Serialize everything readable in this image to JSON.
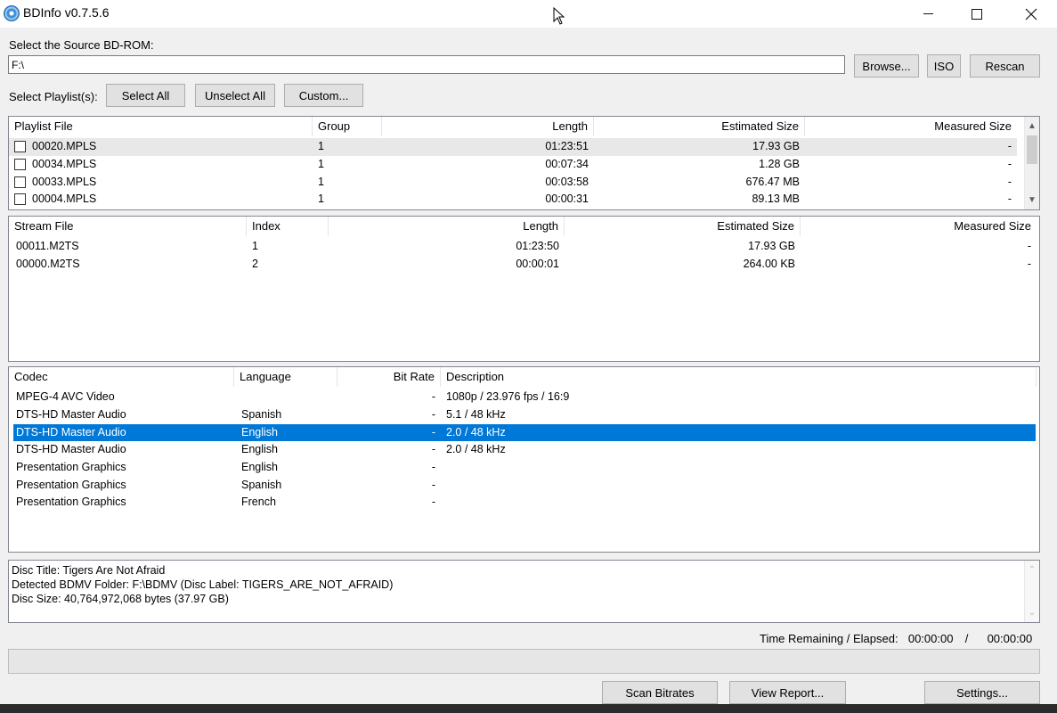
{
  "window": {
    "title": "BDInfo v0.7.5.6"
  },
  "source": {
    "label": "Select the Source BD-ROM:",
    "path": "F:\\",
    "browse": "Browse...",
    "iso": "ISO",
    "rescan": "Rescan"
  },
  "playlist_select": {
    "label": "Select Playlist(s):",
    "select_all": "Select All",
    "unselect_all": "Unselect All",
    "custom": "Custom..."
  },
  "playlists": {
    "columns": [
      "Playlist File",
      "Group",
      "Length",
      "Estimated Size",
      "Measured Size"
    ],
    "rows": [
      {
        "file": "00020.MPLS",
        "group": "1",
        "length": "01:23:51",
        "est": "17.93 GB",
        "meas": "-"
      },
      {
        "file": "00034.MPLS",
        "group": "1",
        "length": "00:07:34",
        "est": "1.28 GB",
        "meas": "-"
      },
      {
        "file": "00033.MPLS",
        "group": "1",
        "length": "00:03:58",
        "est": "676.47 MB",
        "meas": "-"
      },
      {
        "file": "00004.MPLS",
        "group": "1",
        "length": "00:00:31",
        "est": "89.13 MB",
        "meas": "-"
      }
    ]
  },
  "streams": {
    "columns": [
      "Stream File",
      "Index",
      "Length",
      "Estimated Size",
      "Measured Size"
    ],
    "rows": [
      {
        "file": "00011.M2TS",
        "index": "1",
        "length": "01:23:50",
        "est": "17.93 GB",
        "meas": "-"
      },
      {
        "file": "00000.M2TS",
        "index": "2",
        "length": "00:00:01",
        "est": "264.00 KB",
        "meas": "-"
      }
    ]
  },
  "codecs": {
    "columns": [
      "Codec",
      "Language",
      "Bit Rate",
      "Description"
    ],
    "rows": [
      {
        "codec": "MPEG-4 AVC Video",
        "lang": "",
        "bitrate": "-",
        "desc": "1080p / 23.976 fps / 16:9"
      },
      {
        "codec": "DTS-HD Master Audio",
        "lang": "Spanish",
        "bitrate": "-",
        "desc": "5.1 / 48 kHz"
      },
      {
        "codec": "DTS-HD Master Audio",
        "lang": "English",
        "bitrate": "-",
        "desc": "2.0 / 48 kHz"
      },
      {
        "codec": "DTS-HD Master Audio",
        "lang": "English",
        "bitrate": "-",
        "desc": "2.0 / 48 kHz"
      },
      {
        "codec": "Presentation Graphics",
        "lang": "English",
        "bitrate": "-",
        "desc": ""
      },
      {
        "codec": "Presentation Graphics",
        "lang": "Spanish",
        "bitrate": "-",
        "desc": ""
      },
      {
        "codec": "Presentation Graphics",
        "lang": "French",
        "bitrate": "-",
        "desc": ""
      }
    ]
  },
  "info": {
    "line1": "Disc Title: Tigers Are Not Afraid",
    "line2": "Detected BDMV Folder: F:\\BDMV (Disc Label: TIGERS_ARE_NOT_AFRAID)",
    "line3": "Disc Size: 40,764,972,068 bytes (37.97 GB)"
  },
  "time": {
    "label": "Time Remaining / Elapsed:",
    "remaining": "00:00:00",
    "sep": "/",
    "elapsed": "00:00:00"
  },
  "progress": 0,
  "buttons": {
    "scan": "Scan Bitrates",
    "report": "View Report...",
    "settings": "Settings..."
  },
  "icons": {
    "app": "bluray-disc-icon",
    "minimize": "minimize-icon",
    "maximize": "maximize-icon",
    "close": "close-icon"
  },
  "colors": {
    "selection": "#0078d7",
    "window_bg": "#f0f0f0"
  }
}
